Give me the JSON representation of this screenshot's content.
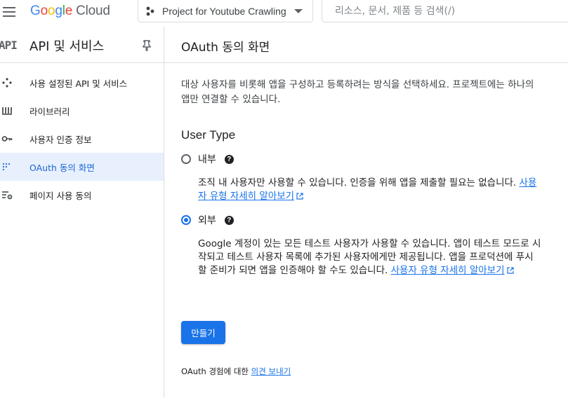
{
  "header": {
    "logo_google": "Google",
    "logo_cloud": "Cloud",
    "project_name": "Project for Youtube Crawling",
    "search_placeholder": "리소스, 문서, 제품 등 검색(/)"
  },
  "sidebar": {
    "badge": "API",
    "title": "API 및 서비스",
    "items": [
      {
        "label": "사용 설정된 API 및 서비스",
        "icon": "apis-icon"
      },
      {
        "label": "라이브러리",
        "icon": "library-icon"
      },
      {
        "label": "사용자 인증 정보",
        "icon": "key-icon"
      },
      {
        "label": "OAuth 동의 화면",
        "icon": "oauth-icon",
        "active": true
      },
      {
        "label": "페이지 사용 동의",
        "icon": "settings-list-icon"
      }
    ]
  },
  "main": {
    "title": "OAuth 동의 화면",
    "intro": "대상 사용자를 비롯해 앱을 구성하고 등록하려는 방식을 선택하세요. 프로젝트에는 하나의 앱만 연결할 수 있습니다.",
    "user_type_heading": "User Type",
    "options": [
      {
        "label": "내부",
        "checked": false,
        "description": "조직 내 사용자만 사용할 수 있습니다. 인증을 위해 앱을 제출할 필요는 없습니다.",
        "link": "사용자 유형 자세히 알아보기"
      },
      {
        "label": "외부",
        "checked": true,
        "description": "Google 계정이 있는 모든 테스트 사용자가 사용할 수 있습니다. 앱이 테스트 모드로 시작되고 테스트 사용자 목록에 추가된 사용자에게만 제공됩니다. 앱을 프로덕션에 푸시할 준비가 되면 앱을 인증해야 할 수도 있습니다.",
        "link": "사용자 유형 자세히 알아보기"
      }
    ],
    "create_button": "만들기",
    "feedback_prefix": "OAuth 경험에 대한",
    "feedback_link": "의견 보내기"
  },
  "colors": {
    "accent": "#1a73e8",
    "active_bg": "#e8f0fe"
  }
}
